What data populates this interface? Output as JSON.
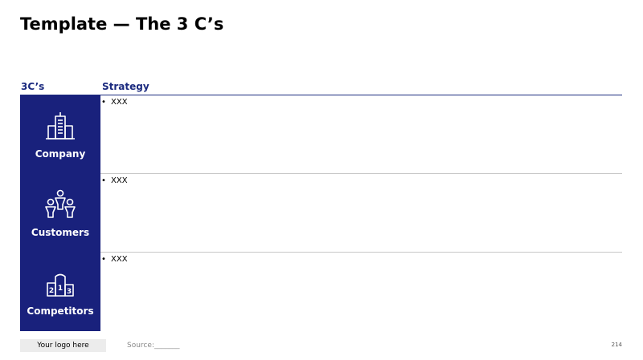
{
  "slide": {
    "title": "Template — The 3 C’s",
    "columns": {
      "left_header": "3C’s",
      "right_header": "Strategy"
    },
    "rows": [
      {
        "label": "Company",
        "icon": "office-building-icon",
        "bullet": "XXX"
      },
      {
        "label": "Customers",
        "icon": "people-group-icon",
        "bullet": "XXX"
      },
      {
        "label": "Competitors",
        "icon": "podium-ranking-icon",
        "bullet": "XXX"
      }
    ],
    "footer": {
      "logo_text": "Your logo here",
      "source_text": "Source:_______",
      "page_number": "214"
    },
    "colors": {
      "accent": "#19217c",
      "header_text": "#1b2a7f"
    }
  }
}
